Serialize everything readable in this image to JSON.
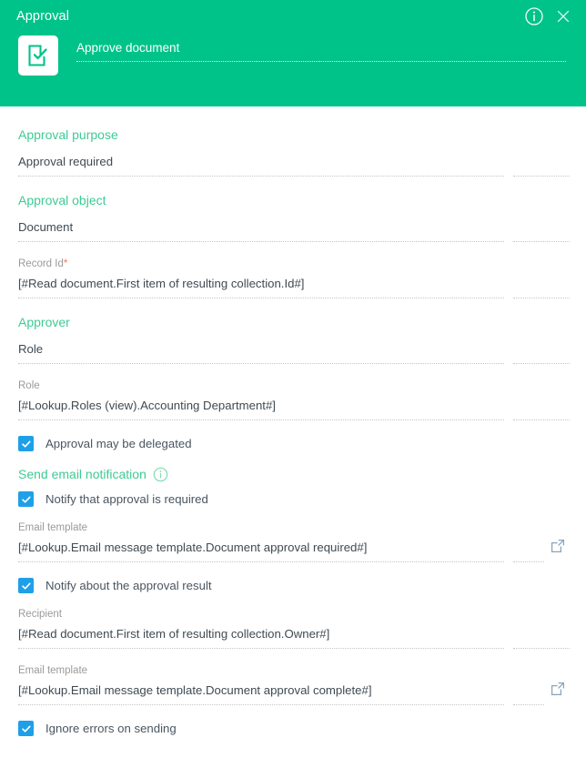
{
  "header": {
    "title": "Approval",
    "info_icon": "info-circle-icon",
    "close_icon": "close-icon",
    "app_icon": "document-check-icon",
    "task_name": "Approve document",
    "accent_color": "#00c389"
  },
  "colors": {
    "header_green": "#00c389",
    "section_label_green": "#3ecb95",
    "checkbox_blue": "#1f9fe8",
    "required_red": "#f4755f",
    "value_text": "#3f4a52",
    "muted_label": "#9a9a9a",
    "dotted_line": "#c6c6c6",
    "action_icon": "#8ba3bd"
  },
  "form": {
    "approval_purpose": {
      "section_label": "Approval purpose",
      "value": "Approval required"
    },
    "approval_object": {
      "section_label": "Approval object",
      "value": "Document"
    },
    "record_id": {
      "label": "Record Id",
      "required_mark": "*",
      "value": "[#Read document.First item of resulting collection.Id#]"
    },
    "approver": {
      "section_label": "Approver",
      "value": "Role"
    },
    "role": {
      "label": "Role",
      "value": "[#Lookup.Roles (view).Accounting Department#]"
    },
    "delegation": {
      "label": "Approval may be delegated",
      "checked": true
    },
    "email_section": {
      "section_label": "Send email notification",
      "info_icon": "info-circle-icon"
    },
    "notify_required": {
      "label": "Notify that approval is required",
      "checked": true
    },
    "email_template_required": {
      "label": "Email template",
      "value": "[#Lookup.Email message template.Document approval required#]",
      "action_icon": "open-external-icon"
    },
    "notify_result": {
      "label": "Notify about the approval result",
      "checked": true
    },
    "recipient": {
      "label": "Recipient",
      "value": "[#Read document.First item of resulting collection.Owner#]"
    },
    "email_template_complete": {
      "label": "Email template",
      "value": "[#Lookup.Email message template.Document approval complete#]",
      "action_icon": "open-external-icon"
    },
    "ignore_errors": {
      "label": "Ignore errors on sending",
      "checked": true
    }
  }
}
